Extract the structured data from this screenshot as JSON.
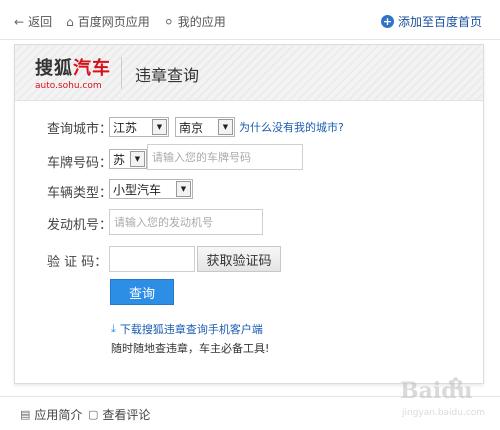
{
  "topbar": {
    "back": "返回",
    "apps": "百度网页应用",
    "my_apps": "我的应用",
    "add_home": "添加至百度首页"
  },
  "header": {
    "logo_part1": "搜狐",
    "logo_part2": "汽车",
    "logo_url": "auto.sohu.com",
    "title": "违章查询"
  },
  "form": {
    "city_label": "查询城市：",
    "province": "江苏",
    "city": "南京",
    "why_no_city": "为什么没有我的城市?",
    "plate_label": "车牌号码：",
    "plate_prefix": "苏",
    "plate_placeholder": "请输入您的车牌号码",
    "vehicle_label": "车辆类型：",
    "vehicle_type": "小型汽车",
    "engine_label": "发动机号：",
    "engine_placeholder": "请输入您的发动机号",
    "captcha_label": "验 证 码：",
    "captcha_value": "",
    "get_code": "获取验证码",
    "submit": "查询"
  },
  "download": {
    "link": "下载搜狐违章查询手机客户端",
    "sub": "随时随地查违章，车主必备工具!"
  },
  "footer": {
    "intro": "应用简介",
    "comments": "查看评论"
  },
  "watermark": {
    "brand": "Baidu",
    "sub": "jingyan.baidu.com"
  }
}
